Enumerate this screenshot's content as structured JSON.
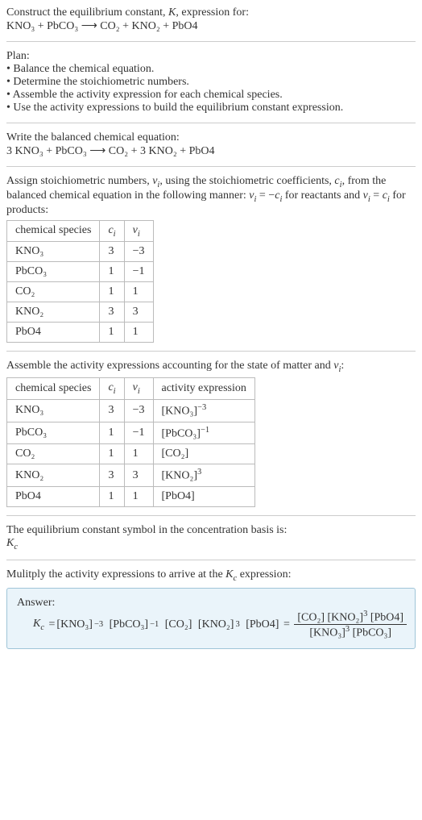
{
  "header": {
    "title_line1": "Construct the equilibrium constant, K, expression for:",
    "equation_unbalanced": "KNO₃ + PbCO₃  ⟶  CO₂ + KNO₂ + PbO4"
  },
  "plan": {
    "heading": "Plan:",
    "items": [
      "• Balance the chemical equation.",
      "• Determine the stoichiometric numbers.",
      "• Assemble the activity expression for each chemical species.",
      "• Use the activity expressions to build the equilibrium constant expression."
    ]
  },
  "balanced": {
    "heading": "Write the balanced chemical equation:",
    "equation": "3 KNO₃ + PbCO₃  ⟶  CO₂ + 3 KNO₂ + PbO4"
  },
  "stoich": {
    "intro": "Assign stoichiometric numbers, νᵢ, using the stoichiometric coefficients, cᵢ, from the balanced chemical equation in the following manner: νᵢ = −cᵢ for reactants and νᵢ = cᵢ for products:",
    "headers": {
      "h1": "chemical species",
      "h2": "cᵢ",
      "h3": "νᵢ"
    },
    "rows": [
      {
        "species": "KNO₃",
        "c": "3",
        "v": "−3"
      },
      {
        "species": "PbCO₃",
        "c": "1",
        "v": "−1"
      },
      {
        "species": "CO₂",
        "c": "1",
        "v": "1"
      },
      {
        "species": "KNO₂",
        "c": "3",
        "v": "3"
      },
      {
        "species": "PbO4",
        "c": "1",
        "v": "1"
      }
    ]
  },
  "activity": {
    "intro": "Assemble the activity expressions accounting for the state of matter and νᵢ:",
    "headers": {
      "h1": "chemical species",
      "h2": "cᵢ",
      "h3": "νᵢ",
      "h4": "activity expression"
    },
    "rows": [
      {
        "species": "KNO₃",
        "c": "3",
        "v": "−3",
        "expr_base": "[KNO₃]",
        "expr_sup": "−3"
      },
      {
        "species": "PbCO₃",
        "c": "1",
        "v": "−1",
        "expr_base": "[PbCO₃]",
        "expr_sup": "−1"
      },
      {
        "species": "CO₂",
        "c": "1",
        "v": "1",
        "expr_base": "[CO₂]",
        "expr_sup": ""
      },
      {
        "species": "KNO₂",
        "c": "3",
        "v": "3",
        "expr_base": "[KNO₂]",
        "expr_sup": "3"
      },
      {
        "species": "PbO4",
        "c": "1",
        "v": "1",
        "expr_base": "[PbO4]",
        "expr_sup": ""
      }
    ]
  },
  "ksymbol": {
    "line1": "The equilibrium constant symbol in the concentration basis is:",
    "symbol": "K_c"
  },
  "final": {
    "intro": "Mulitply the activity expressions to arrive at the K_c expression:",
    "answer_label": "Answer:",
    "lhs": "K_c = ",
    "product_1": "[KNO₃]",
    "product_1_sup": "−3",
    "product_2": "[PbCO₃]",
    "product_2_sup": "−1",
    "product_3": "[CO₂]",
    "product_4": "[KNO₂]",
    "product_4_sup": "3",
    "product_5": "[PbO4]",
    "eq_sign": " = ",
    "frac_num_1": "[CO₂]",
    "frac_num_2": "[KNO₂]",
    "frac_num_2_sup": "3",
    "frac_num_3": "[PbO4]",
    "frac_den_1": "[KNO₃]",
    "frac_den_1_sup": "3",
    "frac_den_2": "[PbCO₃]"
  }
}
